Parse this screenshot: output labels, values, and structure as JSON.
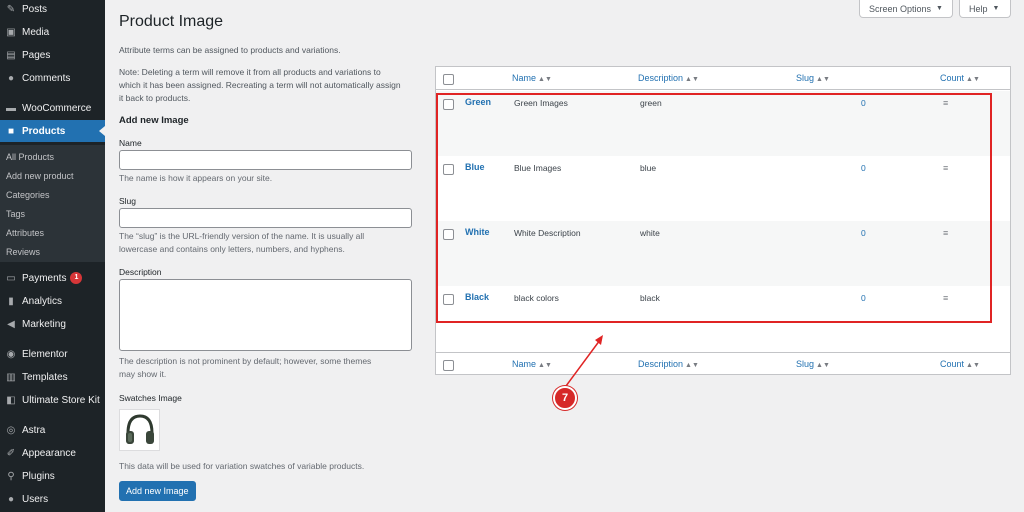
{
  "sidebar": {
    "items": [
      {
        "label": "Posts",
        "icon": "pin-icon"
      },
      {
        "label": "Media",
        "icon": "media-icon"
      },
      {
        "label": "Pages",
        "icon": "pages-icon"
      },
      {
        "label": "Comments",
        "icon": "comments-icon"
      },
      {
        "label": "WooCommerce",
        "icon": "woo-icon"
      },
      {
        "label": "Products",
        "icon": "products-icon"
      },
      {
        "label": "Payments",
        "icon": "payments-icon",
        "badge": "1"
      },
      {
        "label": "Analytics",
        "icon": "analytics-icon"
      },
      {
        "label": "Marketing",
        "icon": "marketing-icon"
      },
      {
        "label": "Elementor",
        "icon": "elementor-icon"
      },
      {
        "label": "Templates",
        "icon": "templates-icon"
      },
      {
        "label": "Ultimate Store Kit",
        "icon": "store-kit-icon"
      },
      {
        "label": "Astra",
        "icon": "astra-icon"
      },
      {
        "label": "Appearance",
        "icon": "appearance-icon"
      },
      {
        "label": "Plugins",
        "icon": "plugins-icon"
      },
      {
        "label": "Users",
        "icon": "users-icon"
      }
    ],
    "submenu": [
      "All Products",
      "Add new product",
      "Categories",
      "Tags",
      "Attributes",
      "Reviews"
    ]
  },
  "header": {
    "screen_options": "Screen Options",
    "help": "Help",
    "title": "Product Image"
  },
  "intro": "Attribute terms can be assigned to products and variations.",
  "note_lines": [
    "Note: Deleting a term will remove it from all products and variations to",
    "which it has been assigned. Recreating a term will not automatically assign",
    "it back to products."
  ],
  "form": {
    "heading": "Add new Image",
    "name_label": "Name",
    "name_value": "",
    "name_help": "The name is how it appears on your site.",
    "slug_label": "Slug",
    "slug_value": "",
    "slug_help_1": "The “slug” is the URL-friendly version of the name. It is usually all",
    "slug_help_2": "lowercase and contains only letters, numbers, and hyphens.",
    "description_label": "Description",
    "description_value": "",
    "description_help_1": "The description is not prominent by default; however, some themes",
    "description_help_2": "may show it.",
    "swatches_label": "Swatches Image",
    "swatches_help": "This data will be used for variation swatches of variable products.",
    "submit": "Add new Image"
  },
  "table": {
    "columns": {
      "name": "Name",
      "description": "Description",
      "slug": "Slug",
      "count": "Count"
    },
    "rows": [
      {
        "name": "Green",
        "description": "Green Images",
        "slug": "green",
        "count": "0"
      },
      {
        "name": "Blue",
        "description": "Blue Images",
        "slug": "blue",
        "count": "0"
      },
      {
        "name": "White",
        "description": "White Description",
        "slug": "white",
        "count": "0"
      },
      {
        "name": "Black",
        "description": "black colors",
        "slug": "black",
        "count": "0"
      }
    ]
  },
  "annotation": {
    "marker": "7",
    "color": "#e02424"
  },
  "colors": {
    "sidebar": "#1d2327",
    "accent": "#2271b1",
    "badge": "#d63638"
  }
}
